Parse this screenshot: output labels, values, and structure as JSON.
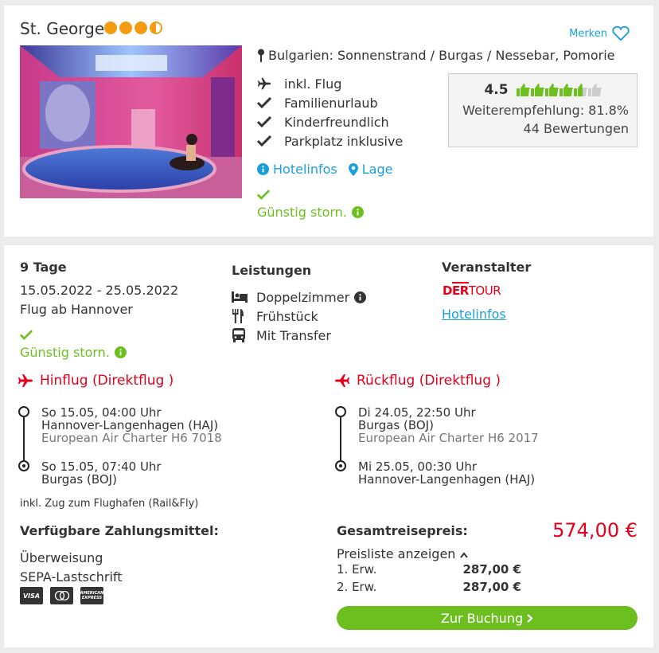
{
  "hotel": {
    "name": "St. George",
    "stars": 3.5,
    "merken_label": "Merken",
    "location": "Bulgarien: Sonnenstrand / Burgas / Nessebar, Pomorie",
    "features": [
      "inkl. Flug",
      "Familienurlaub",
      "Kinderfreundlich",
      "Parkplatz inklusive"
    ],
    "links": {
      "hotelinfos": "Hotelinfos",
      "lage": "Lage"
    },
    "storno": "Günstig storn.",
    "review": {
      "score": "4.5",
      "thumbs": 4.5,
      "recommend": "Weiterempfehlung: 81.8%",
      "count": "44 Bewertungen"
    }
  },
  "offer": {
    "duration": "9 Tage",
    "dates": "15.05.2022 - 25.05.2022",
    "departure": "Flug ab Hannover",
    "storno": "Günstig storn.",
    "leistungen_title": "Leistungen",
    "leistungen": [
      "Doppelzimmer",
      "Frühstück",
      "Mit Transfer"
    ],
    "veranstalter_title": "Veranstalter",
    "operator_logo": "DERTOUR",
    "veranstalter_link": "Hotelinfos"
  },
  "flights": {
    "outbound": {
      "title": "Hinflug (Direktflug )",
      "dep_time": "So 15.05, 04:00 Uhr",
      "dep_airport": "Hannover-Langenhagen (HAJ)",
      "airline": "European Air Charter H6 7018",
      "arr_time": "So 15.05, 07:40 Uhr",
      "arr_airport": "Burgas (BOJ)"
    },
    "return": {
      "title": "Rückflug (Direktflug )",
      "dep_time": "Di 24.05, 22:50 Uhr",
      "dep_airport": "Burgas (BOJ)",
      "airline": "European Air Charter H6 2017",
      "arr_time": "Mi 25.05, 00:30 Uhr",
      "arr_airport": "Hannover-Langenhagen (HAJ)"
    },
    "rail_note": "inkl. Zug zum Flughafen (Rail&Fly)"
  },
  "payment": {
    "title": "Verfügbare Zahlungsmittel:",
    "methods": [
      "Überweisung",
      "SEPA-Lastschrift"
    ],
    "cards": [
      "VISA",
      "Mastercard",
      "American Express"
    ]
  },
  "price": {
    "title": "Gesamtreisepreis:",
    "total": "574,00 €",
    "list_toggle": "Preisliste anzeigen",
    "rows": [
      {
        "label": "1. Erw.",
        "value": "287,00 €"
      },
      {
        "label": "2. Erw.",
        "value": "287,00 €"
      }
    ],
    "book_label": "Zur Buchung"
  },
  "colors": {
    "accent_blue": "#1a9fd9",
    "green": "#6cbf1e",
    "red": "#e2001a",
    "orange": "#f39c12"
  }
}
